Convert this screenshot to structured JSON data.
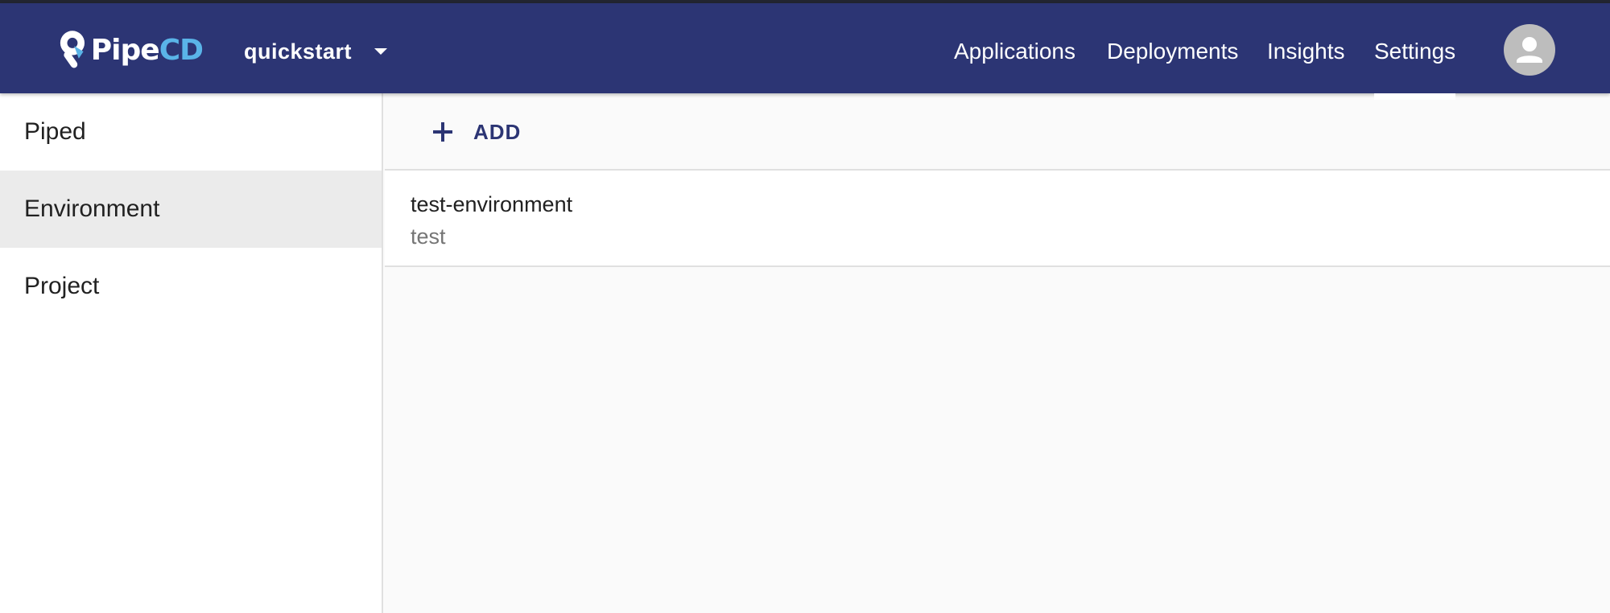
{
  "header": {
    "logo": {
      "pipe": "Pipe",
      "cd": "CD"
    },
    "project": "quickstart",
    "nav": [
      {
        "label": "Applications"
      },
      {
        "label": "Deployments"
      },
      {
        "label": "Insights"
      },
      {
        "label": "Settings",
        "active": true
      }
    ],
    "avatar_icon": "user-avatar-icon"
  },
  "sidebar": {
    "items": [
      {
        "label": "Piped"
      },
      {
        "label": "Environment",
        "selected": true
      },
      {
        "label": "Project"
      }
    ]
  },
  "main": {
    "add_label": "ADD",
    "environments": [
      {
        "name": "test-environment",
        "desc": "test"
      }
    ]
  },
  "colors": {
    "appbar": "#2c3574",
    "accent": "#5ab4e8",
    "selected_bg": "#ebebeb"
  }
}
